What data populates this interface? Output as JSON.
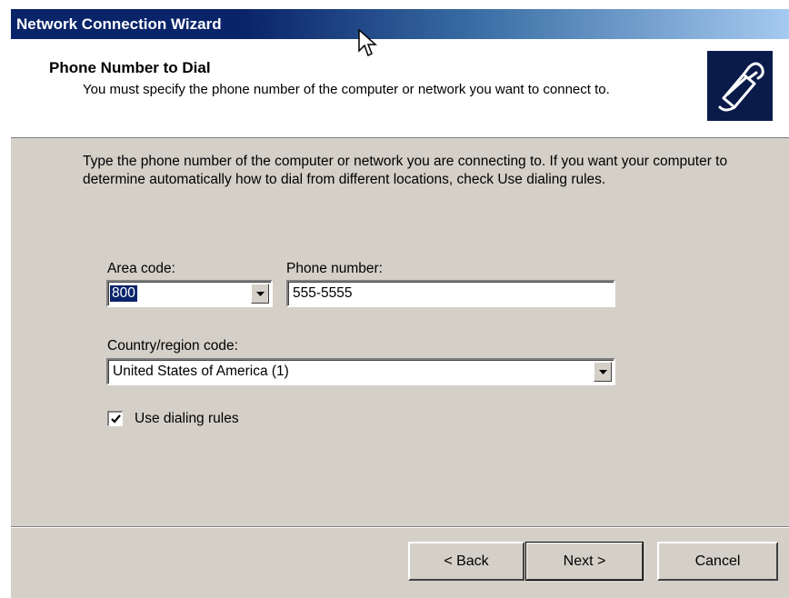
{
  "window": {
    "title": "Network Connection Wizard"
  },
  "header": {
    "title": "Phone Number to Dial",
    "subtitle": "You must specify the phone number of the computer or network you want to connect to.",
    "icon": "phone-plug-icon"
  },
  "body": {
    "description": "Type the phone number of the computer or network you are connecting to. If you want your computer to determine automatically how to dial from different locations, check Use dialing rules."
  },
  "form": {
    "area_code": {
      "label": "Area code:",
      "value": "800"
    },
    "phone_number": {
      "label": "Phone number:",
      "value": "555-5555"
    },
    "country_code": {
      "label": "Country/region code:",
      "value": "United States of America (1)"
    },
    "use_dialing_rules": {
      "label": "Use dialing rules",
      "checked": true
    }
  },
  "buttons": {
    "back": "< Back",
    "next": "Next >",
    "cancel": "Cancel"
  },
  "colors": {
    "titlebar_start": "#0a246a",
    "titlebar_end": "#a6caf0",
    "dialog_face": "#d4d0c8",
    "selection": "#0a246a"
  }
}
